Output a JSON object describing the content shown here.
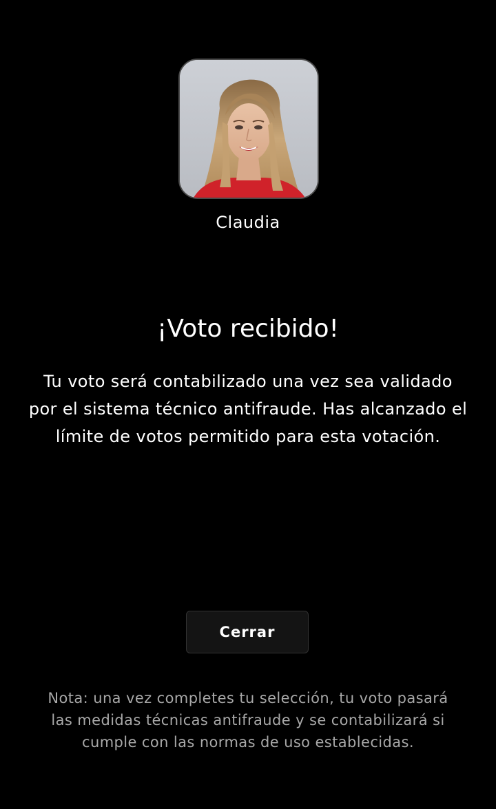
{
  "contestant": {
    "name": "Claudia",
    "photo": "contestant-portrait"
  },
  "confirmation": {
    "title": "¡Voto recibido!",
    "message": "Tu voto será contabilizado una vez sea validado por el sistema técnico antifraude. Has alcanzado el límite de votos permitido para esta votación."
  },
  "actions": {
    "close_label": "Cerrar"
  },
  "footer": {
    "note": "Nota: una vez completes tu selección, tu voto pasará las medidas técnicas antifraude y se contabilizará si cumple con las normas de uso establecidas."
  },
  "colors": {
    "background": "#000000",
    "text": "#ffffff",
    "muted_text": "#a8a8a8",
    "button_background": "#141414",
    "button_border": "#333333"
  }
}
